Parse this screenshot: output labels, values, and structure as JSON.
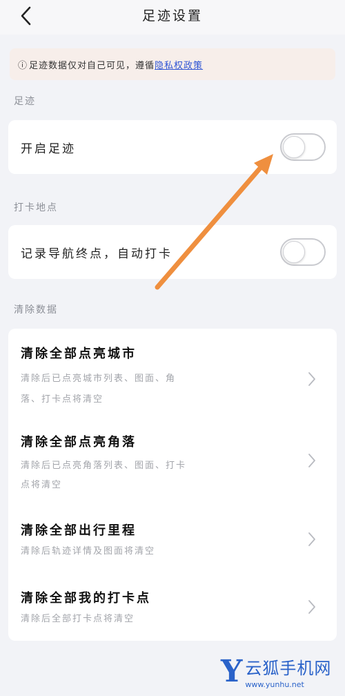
{
  "header": {
    "title": "足迹设置",
    "back_icon": "chevron-left-icon"
  },
  "notice": {
    "icon": "info-circle-icon",
    "icon_glyph": "ⓘ",
    "text": "足迹数据仅对自己可见，遵循",
    "link": "隐私权政策"
  },
  "sections": {
    "footprint_label": "足迹",
    "checkin_label": "打卡地点",
    "clear_label": "清除数据"
  },
  "switches": {
    "footprint": {
      "label": "开启足迹",
      "on": false
    },
    "checkin": {
      "label": "记录导航终点，自动打卡",
      "on": false
    }
  },
  "clear_items": [
    {
      "title": "清除全部点亮城市",
      "desc_line1": "清除后已点亮城市列表、图面、角",
      "desc_line2": "落、打卡点将清空"
    },
    {
      "title": "清除全部点亮角落",
      "desc_line1": "清除后已点亮角落列表、图面、打卡",
      "desc_line2": "点将清空"
    },
    {
      "title": "清除全部出行里程",
      "desc_line1": "清除后轨迹详情及图面将清空",
      "desc_line2": ""
    },
    {
      "title": "清除全部我的打卡点",
      "desc_line1": "清除后全部打卡点将清空",
      "desc_line2": ""
    }
  ],
  "annotation": {
    "color": "#ef8f3f"
  },
  "watermark": {
    "logo": "Y",
    "name": "云狐手机网",
    "url": "www.yunhu.net"
  },
  "colors": {
    "background": "#f2f3f7",
    "notice_bg": "#f7eeea",
    "link": "#2f55d4",
    "watermark": "#2a62c9"
  }
}
